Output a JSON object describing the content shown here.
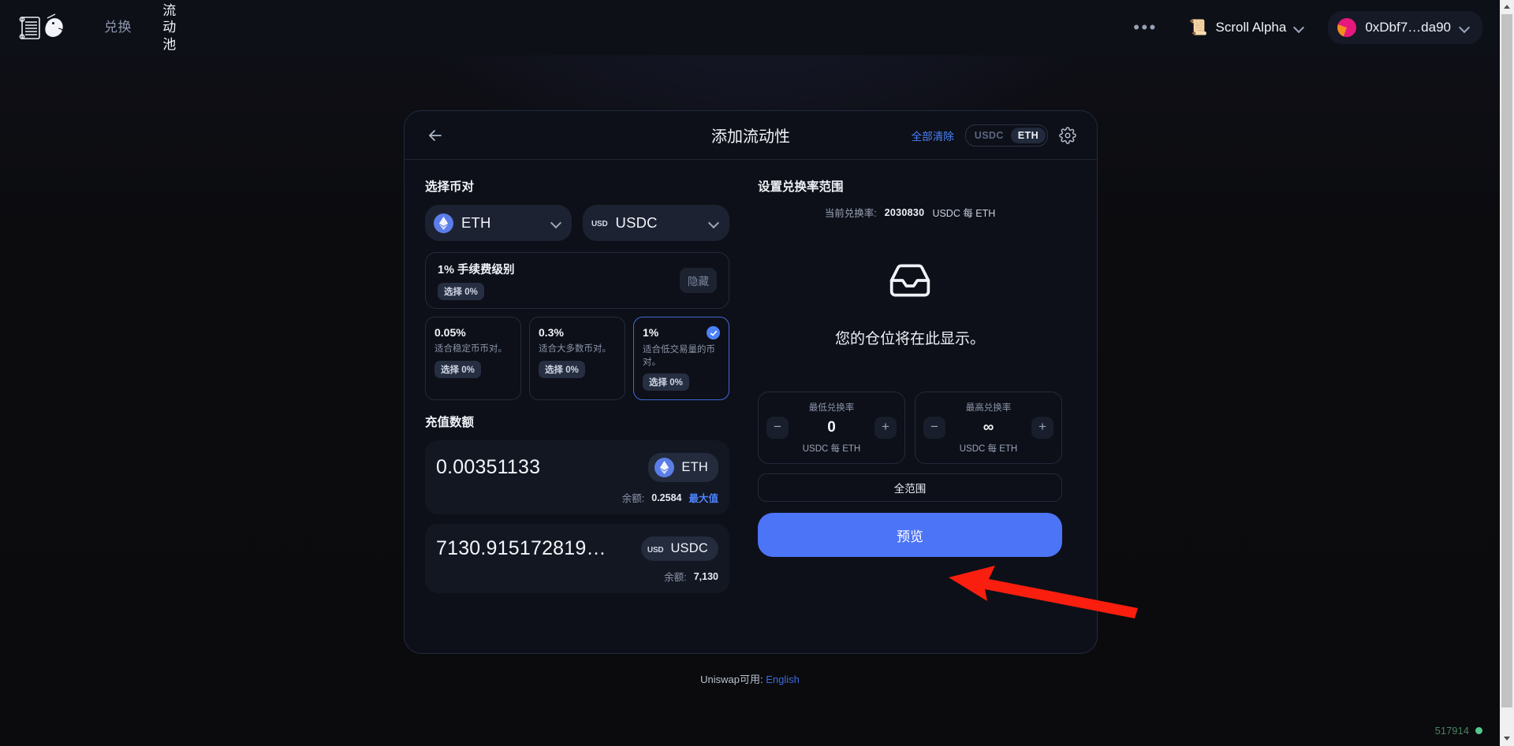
{
  "navbar": {
    "logo_icon": "uniswap-unicorn-logo",
    "links": [
      {
        "label": "兑换",
        "active": false
      },
      {
        "label": "流动\n池",
        "active": true
      }
    ],
    "more_icon": "ellipsis-icon",
    "chain": {
      "icon": "scroll-icon",
      "label": "Scroll Alpha",
      "chevron": "chevron-down-icon"
    },
    "account": {
      "label": "0xDbf7…da90",
      "chevron": "chevron-down-icon",
      "avatar": "wallet-avatar"
    }
  },
  "card": {
    "back_icon": "back-arrow-icon",
    "title": "添加流动性",
    "clear_all": "全部清除",
    "toggle": {
      "options": [
        "USDC",
        "ETH"
      ],
      "selected": "ETH"
    },
    "settings_icon": "gear-icon"
  },
  "left": {
    "pair_title": "选择币对",
    "tokens": [
      {
        "symbol": "ETH",
        "icon": "eth-token-icon",
        "badge": ""
      },
      {
        "symbol": "USDC",
        "icon": "usdc-token-icon",
        "badge": "USD"
      }
    ],
    "fee_banner": {
      "title": "1% 手续费级别",
      "pill": "选择 0%",
      "hide_label": "隐藏"
    },
    "fee_options": [
      {
        "percent": "0.05%",
        "desc": "适合稳定币币对。",
        "pill": "选择 0%",
        "selected": false
      },
      {
        "percent": "0.3%",
        "desc": "适合大多数币对。",
        "pill": "选择 0%",
        "selected": false
      },
      {
        "percent": "1%",
        "desc": "适合低交易量的币对。",
        "pill": "选择 0%",
        "selected": true
      }
    ],
    "deposit_title": "充值数额",
    "deposits": [
      {
        "amount": "0.00351133",
        "token": "ETH",
        "token_badge": "",
        "balance_label": "余额:",
        "balance": "0.2584",
        "max_label": "最大值"
      },
      {
        "amount": "7130.915172819…",
        "token": "USDC",
        "token_badge": "USD",
        "balance_label": "余额:",
        "balance": "7,130",
        "max_label": ""
      }
    ]
  },
  "right": {
    "range_title": "设置兑换率范围",
    "current_rate_label": "当前兑换率:",
    "current_rate_value": "2030830",
    "current_rate_unit": "USDC 每 ETH",
    "placeholder_icon": "inbox-icon",
    "placeholder_text": "您的仓位将在此显示。",
    "min": {
      "label": "最低兑换率",
      "value": "0",
      "unit": "USDC 每 ETH",
      "minus": "−",
      "plus": "+"
    },
    "max": {
      "label": "最高兑换率",
      "value": "∞",
      "unit": "USDC 每 ETH",
      "minus": "−",
      "plus": "+"
    },
    "full_range": "全范围",
    "preview": "预览"
  },
  "footer": {
    "prefix": "Uniswap可用:",
    "language": "English"
  },
  "status": {
    "block": "517914",
    "dot_color": "#55c98b"
  },
  "colors": {
    "accent_blue": "#4c82fb",
    "primary_button": "#4c74f7",
    "card_bg": "#0d1018",
    "page_bg": "#0b0b0d",
    "annotation_red": "#fa1e0e"
  }
}
